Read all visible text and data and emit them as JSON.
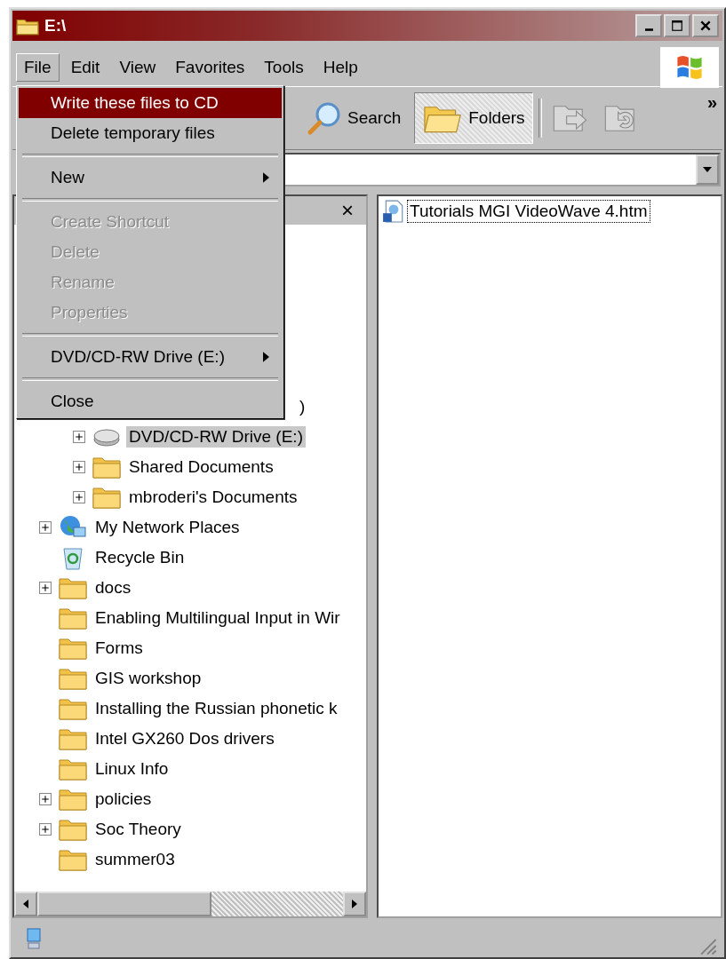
{
  "window": {
    "title": "E:\\"
  },
  "menu_bar": [
    {
      "label": "File",
      "selected": true
    },
    {
      "label": "Edit",
      "selected": false
    },
    {
      "label": "View",
      "selected": false
    },
    {
      "label": "Favorites",
      "selected": false
    },
    {
      "label": "Tools",
      "selected": false
    },
    {
      "label": "Help",
      "selected": false
    }
  ],
  "toolbar": {
    "buttons": [
      {
        "label": "Search",
        "selected": false
      },
      {
        "label": "Folders",
        "selected": true
      }
    ],
    "icon_buttons": [
      {
        "disabled": true
      },
      {
        "disabled": true
      }
    ],
    "overflow": "»"
  },
  "file_menu": [
    {
      "kind": "item",
      "label": "Write these files to CD",
      "selected": true,
      "disabled": false,
      "submenu": false
    },
    {
      "kind": "item",
      "label": "Delete temporary files",
      "selected": false,
      "disabled": false,
      "submenu": false
    },
    {
      "kind": "separator"
    },
    {
      "kind": "item",
      "label": "New",
      "selected": false,
      "disabled": false,
      "submenu": true
    },
    {
      "kind": "separator"
    },
    {
      "kind": "item",
      "label": "Create Shortcut",
      "selected": false,
      "disabled": true,
      "submenu": false
    },
    {
      "kind": "item",
      "label": "Delete",
      "selected": false,
      "disabled": true,
      "submenu": false
    },
    {
      "kind": "item",
      "label": "Rename",
      "selected": false,
      "disabled": true,
      "submenu": false
    },
    {
      "kind": "item",
      "label": "Properties",
      "selected": false,
      "disabled": true,
      "submenu": false
    },
    {
      "kind": "separator"
    },
    {
      "kind": "item",
      "label": "DVD/CD-RW Drive (E:)",
      "selected": false,
      "disabled": false,
      "submenu": true
    },
    {
      "kind": "separator"
    },
    {
      "kind": "item",
      "label": "Close",
      "selected": false,
      "disabled": false,
      "submenu": false
    }
  ],
  "folders_pane": {
    "close": "×"
  },
  "tree": [
    {
      "kind": "group",
      "children": [
        {
          "kind": "covered",
          "label": ")"
        },
        {
          "kind": "drive",
          "label": "DVD/CD-RW Drive (E:)",
          "expander": true,
          "selected": true
        },
        {
          "kind": "folder",
          "label": "Shared Documents",
          "expander": true,
          "selected": false
        },
        {
          "kind": "folder",
          "label": "mbroderi's Documents",
          "expander": true,
          "selected": false
        }
      ]
    },
    {
      "kind": "network",
      "label": "My Network Places",
      "expander": true,
      "selected": false
    },
    {
      "kind": "recycle",
      "label": "Recycle Bin",
      "expander": false,
      "selected": false
    },
    {
      "kind": "folder",
      "label": "docs",
      "expander": true,
      "selected": false
    },
    {
      "kind": "folder",
      "label": "Enabling Multilingual Input in Wir",
      "expander": false,
      "selected": false
    },
    {
      "kind": "folder",
      "label": "Forms",
      "expander": false,
      "selected": false
    },
    {
      "kind": "folder",
      "label": "GIS workshop",
      "expander": false,
      "selected": false
    },
    {
      "kind": "folder",
      "label": "Installing the Russian phonetic k",
      "expander": false,
      "selected": false
    },
    {
      "kind": "folder",
      "label": "Intel GX260 Dos drivers",
      "expander": false,
      "selected": false
    },
    {
      "kind": "folder",
      "label": "Linux Info",
      "expander": false,
      "selected": false
    },
    {
      "kind": "folder",
      "label": "policies",
      "expander": true,
      "selected": false
    },
    {
      "kind": "folder",
      "label": "Soc Theory",
      "expander": true,
      "selected": false
    },
    {
      "kind": "folder",
      "label": "summer03",
      "expander": false,
      "selected": false
    }
  ],
  "files": [
    {
      "name": "Tutorials MGI VideoWave 4.htm",
      "selected": true
    }
  ]
}
